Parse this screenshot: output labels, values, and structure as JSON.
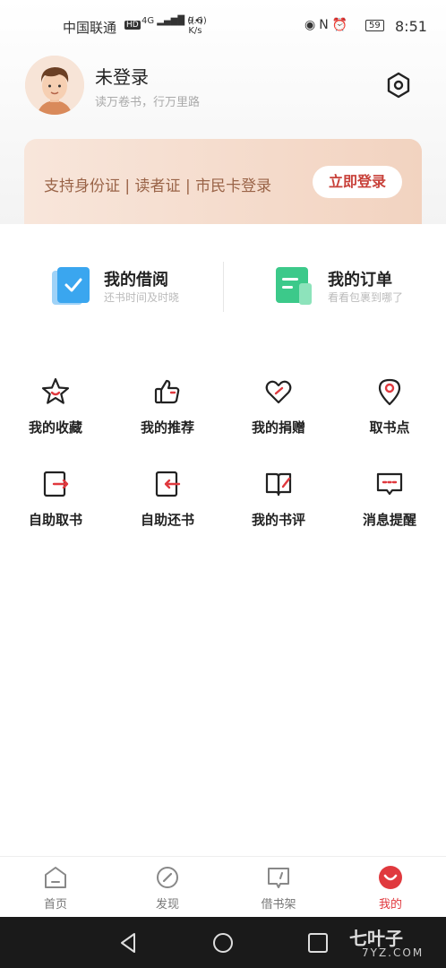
{
  "status_bar": {
    "carrier": "中国联通",
    "hd_badge": "HD",
    "network": "4G",
    "speed_value": "9.6",
    "speed_unit": "K/s",
    "battery": "59",
    "time": "8:51"
  },
  "profile": {
    "username": "未登录",
    "slogan": "读万卷书，行万里路"
  },
  "login_banner": {
    "text": "支持身份证 | 读者证 | 市民卡登录",
    "button_label": "立即登录"
  },
  "quick_links": [
    {
      "title": "我的借阅",
      "subtitle": "还书时间及时晓"
    },
    {
      "title": "我的订单",
      "subtitle": "看看包裹到哪了"
    }
  ],
  "grid": [
    {
      "label": "我的收藏",
      "icon": "star-icon"
    },
    {
      "label": "我的推荐",
      "icon": "thumbs-up-icon"
    },
    {
      "label": "我的捐赠",
      "icon": "heart-icon"
    },
    {
      "label": "取书点",
      "icon": "location-pin-icon"
    },
    {
      "label": "自助取书",
      "icon": "pickup-box-icon"
    },
    {
      "label": "自助还书",
      "icon": "return-box-icon"
    },
    {
      "label": "我的书评",
      "icon": "book-review-icon"
    },
    {
      "label": "消息提醒",
      "icon": "message-icon"
    }
  ],
  "tabs": [
    {
      "label": "首页",
      "icon": "home-icon",
      "active": false
    },
    {
      "label": "发现",
      "icon": "compass-icon",
      "active": false
    },
    {
      "label": "借书架",
      "icon": "bookshelf-icon",
      "active": false
    },
    {
      "label": "我的",
      "icon": "profile-smile-icon",
      "active": true
    }
  ],
  "watermark": {
    "title": "七叶子",
    "subtitle": "7YZ.COM"
  },
  "colors": {
    "accent": "#e0393e",
    "banner_text": "#9a6448",
    "borrow_icon": "#3aa6ef",
    "order_icon": "#3cc98a"
  }
}
